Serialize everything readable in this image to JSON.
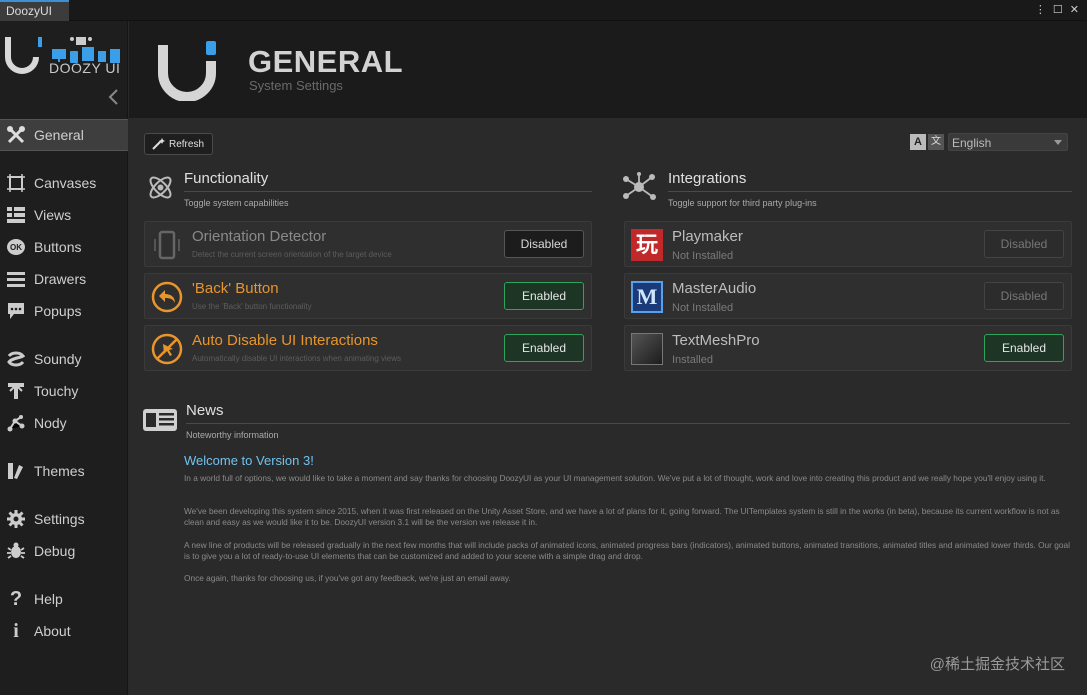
{
  "window": {
    "tab_title": "DoozyUI"
  },
  "logo": {
    "text": "DOOZY UI"
  },
  "sidebar": {
    "items": [
      {
        "label": "General"
      },
      {
        "label": "Canvases"
      },
      {
        "label": "Views"
      },
      {
        "label": "Buttons"
      },
      {
        "label": "Drawers"
      },
      {
        "label": "Popups"
      },
      {
        "label": "Soundy"
      },
      {
        "label": "Touchy"
      },
      {
        "label": "Nody"
      },
      {
        "label": "Themes"
      },
      {
        "label": "Settings"
      },
      {
        "label": "Debug"
      },
      {
        "label": "Help"
      },
      {
        "label": "About"
      }
    ]
  },
  "header": {
    "title": "GENERAL",
    "subtitle": "System Settings"
  },
  "toolbar": {
    "refresh_label": "Refresh",
    "language": "English"
  },
  "functionality": {
    "title": "Functionality",
    "subtitle": "Toggle system capabilities",
    "items": [
      {
        "name": "Orientation Detector",
        "description": "Detect the current screen orientation of the target device",
        "status": "Disabled"
      },
      {
        "name": "'Back' Button",
        "description": "Use the 'Back' button functionality",
        "status": "Enabled"
      },
      {
        "name": "Auto Disable UI Interactions",
        "description": "Automatically disable UI interactions when animating views",
        "status": "Enabled"
      }
    ]
  },
  "integrations": {
    "title": "Integrations",
    "subtitle": "Toggle support for third party plug-ins",
    "items": [
      {
        "name": "Playmaker",
        "install_status": "Not Installed",
        "status": "Disabled"
      },
      {
        "name": "MasterAudio",
        "install_status": "Not Installed",
        "status": "Disabled"
      },
      {
        "name": "TextMeshPro",
        "install_status": "Installed",
        "status": "Enabled"
      }
    ]
  },
  "news": {
    "title": "News",
    "subtitle": "Noteworthy information",
    "headline": "Welcome to Version 3!",
    "paragraphs": [
      "In a world full of options, we would like to take a moment and say thanks for choosing DoozyUI as your UI management solution. We've put a lot of thought, work and love into creating this product and we really hope you'll enjoy using it.",
      "We've been developing this system since 2015, when it was first released on the Unity Asset Store, and we have a lot of plans for it, going forward. The UITemplates system is still in the works (in beta), because its current workflow is not as clean and easy as we would like it to be. DoozyUI version 3.1 will be the version we release it in.",
      "A new line of products will be released gradually in the next few months that will include packs of animated icons, animated progress bars (indicators), animated buttons, animated transitions, animated titles and animated lower thirds. Our goal is to give you a lot of ready-to-use UI elements that can be customized and added to your scene with a simple drag and drop.",
      "Once again, thanks for choosing us, if you've got any feedback, we're just an email away."
    ]
  },
  "watermark": {
    "text": "@稀土掘金技术社区"
  },
  "colors": {
    "accent_blue": "#3a9ee8",
    "enabled_green": "#2ea35b",
    "feature_orange": "#e8952c",
    "headline_blue": "#6fc3f0"
  }
}
